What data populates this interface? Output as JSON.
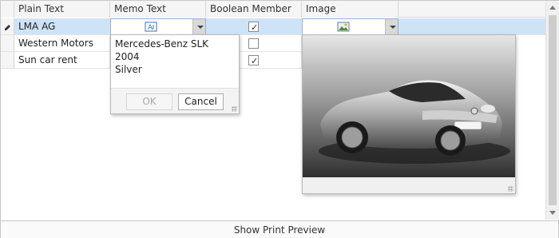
{
  "columns": [
    "Plain Text",
    "Memo Text",
    "Boolean Member",
    "Image"
  ],
  "rows": [
    {
      "plain_text": "LMA AG",
      "boolean": true
    },
    {
      "plain_text": "Western Motors",
      "boolean": false
    },
    {
      "plain_text": "Sun car rent",
      "boolean": true
    }
  ],
  "memo_popup": {
    "lines": [
      "Mercedes-Benz SLK",
      "2004",
      "Silver"
    ],
    "ok_label": "OK",
    "cancel_label": "Cancel"
  },
  "image_popup": {
    "subject": "silver sports car"
  },
  "footer": {
    "label": "Show Print Preview"
  },
  "colors": {
    "focused_row": "#cfe3f7",
    "header_bg": "#f5f5f5",
    "border": "#d6d6d6"
  }
}
